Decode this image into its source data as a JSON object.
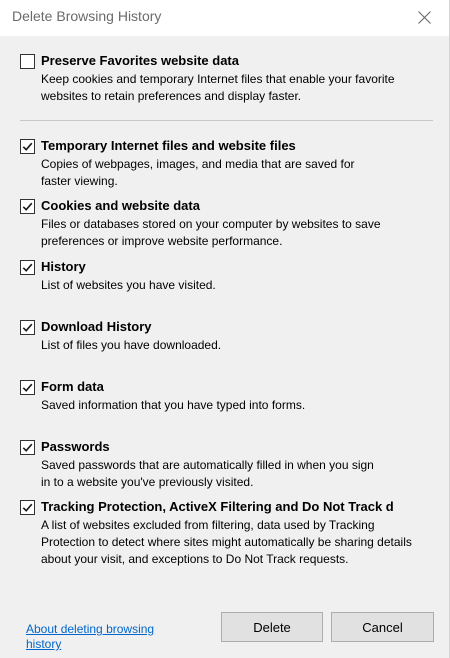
{
  "window": {
    "title": "Delete Browsing History",
    "close_icon": "close-icon"
  },
  "options": [
    {
      "label": "Preserve Favorites website data",
      "checked": false,
      "desc": [
        "Keep cookies and temporary Internet files that enable your favorite",
        "websites to retain preferences and display faster."
      ]
    },
    {
      "label": "Temporary Internet files and website files",
      "checked": true,
      "desc": [
        "Copies of webpages, images, and media that are saved for",
        "faster viewing."
      ]
    },
    {
      "label": "Cookies and website data",
      "checked": true,
      "desc": [
        "Files or databases stored on your computer by websites to save",
        "preferences or improve website performance."
      ]
    },
    {
      "label": "History",
      "checked": true,
      "desc": [
        "List of websites you have visited."
      ]
    },
    {
      "label": "Download History",
      "checked": true,
      "desc": [
        "List of files you have downloaded."
      ]
    },
    {
      "label": "Form data",
      "checked": true,
      "desc": [
        "Saved information that you have typed into forms."
      ]
    },
    {
      "label": "Passwords",
      "checked": true,
      "desc": [
        "Saved passwords that are automatically filled in when you sign",
        "in to a website you've previously visited."
      ]
    },
    {
      "label": "Tracking Protection, ActiveX Filtering and Do Not Track d",
      "checked": true,
      "desc": [
        "A list of websites excluded from filtering, data used by Tracking",
        "Protection to detect where sites might automatically be sharing details",
        "about your visit, and exceptions to Do Not Track requests."
      ]
    }
  ],
  "footer": {
    "about_link": [
      "About deleting browsing",
      "history"
    ],
    "delete_label": "Delete",
    "cancel_label": "Cancel"
  },
  "colors": {
    "content_bg": "#f0f0f0",
    "link": "#0066cc",
    "button_bg": "#e1e1e1"
  }
}
